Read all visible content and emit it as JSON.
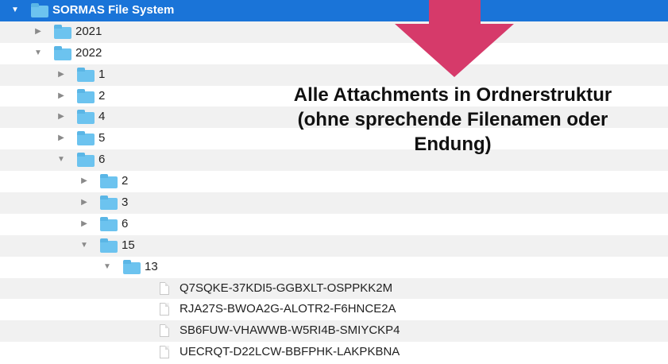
{
  "tree": {
    "rows": [
      {
        "label": "SORMAS File System",
        "kind": "folder",
        "expanded": true,
        "selected": true,
        "level": 0
      },
      {
        "label": "2021",
        "kind": "folder",
        "expanded": false,
        "level": 1
      },
      {
        "label": "2022",
        "kind": "folder",
        "expanded": true,
        "level": 1
      },
      {
        "label": "1",
        "kind": "folder",
        "expanded": false,
        "level": 2
      },
      {
        "label": "2",
        "kind": "folder",
        "expanded": false,
        "level": 2
      },
      {
        "label": "4",
        "kind": "folder",
        "expanded": false,
        "level": 2
      },
      {
        "label": "5",
        "kind": "folder",
        "expanded": false,
        "level": 2
      },
      {
        "label": "6",
        "kind": "folder",
        "expanded": true,
        "level": 2
      },
      {
        "label": "2",
        "kind": "folder",
        "expanded": false,
        "level": 3
      },
      {
        "label": "3",
        "kind": "folder",
        "expanded": false,
        "level": 3
      },
      {
        "label": "6",
        "kind": "folder",
        "expanded": false,
        "level": 3
      },
      {
        "label": "15",
        "kind": "folder",
        "expanded": true,
        "level": 3
      },
      {
        "label": "13",
        "kind": "folder",
        "expanded": true,
        "level": 4
      },
      {
        "label": "Q7SQKE-37KDI5-GGBXLT-OSPPKK2M",
        "kind": "file",
        "level": 5
      },
      {
        "label": "RJA27S-BWOA2G-ALOTR2-F6HNCE2A",
        "kind": "file",
        "level": 5
      },
      {
        "label": "SB6FUW-VHAWWB-W5RI4B-SMIYCKP4",
        "kind": "file",
        "level": 5
      },
      {
        "label": "UECRQT-D22LCW-BBFPHK-LAKPKBNA",
        "kind": "file",
        "level": 5
      }
    ]
  },
  "annotation": {
    "text": "Alle Attachments in Ordnerstruktur (ohne sprechende Filenamen oder Endung)",
    "arrow_color": "#d63a6a"
  },
  "colors": {
    "selection": "#1a74d8",
    "folder": "#6cc3ef",
    "row_stripe": "#f1f1f1"
  }
}
